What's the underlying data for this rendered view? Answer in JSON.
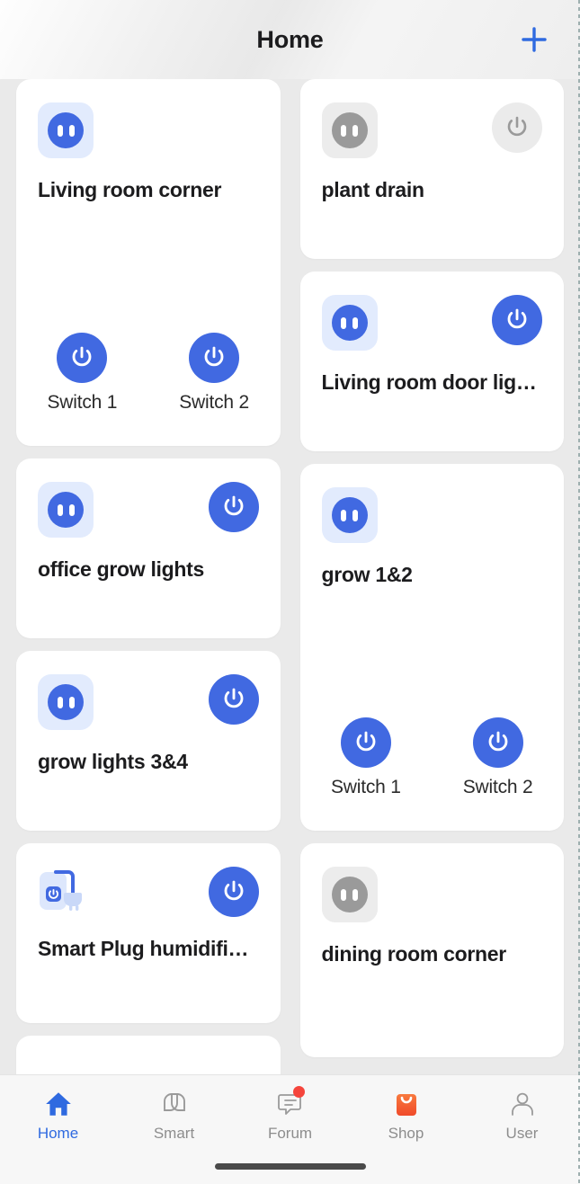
{
  "header": {
    "title": "Home",
    "add_icon": "plus-icon"
  },
  "columns": [
    {
      "cards": [
        {
          "name": "Living room corner",
          "icon": "outlet-icon",
          "state": "on",
          "has_power_button": false,
          "switches": [
            {
              "label": "Switch 1",
              "state": "on"
            },
            {
              "label": "Switch 2",
              "state": "on"
            }
          ]
        },
        {
          "name": "office grow lights",
          "icon": "outlet-icon",
          "state": "on",
          "has_power_button": true,
          "power_state": "on",
          "switches": []
        },
        {
          "name": "grow lights 3&4",
          "icon": "outlet-icon",
          "state": "on",
          "has_power_button": true,
          "power_state": "on",
          "switches": []
        },
        {
          "name": "Smart Plug humidifi…",
          "icon": "smart-plug-icon",
          "state": "on",
          "has_power_button": true,
          "power_state": "on",
          "switches": []
        }
      ]
    },
    {
      "cards": [
        {
          "name": "plant drain",
          "icon": "outlet-icon",
          "state": "off",
          "has_power_button": true,
          "power_state": "off",
          "switches": []
        },
        {
          "name": "Living room door lig…",
          "icon": "outlet-icon",
          "state": "on",
          "has_power_button": true,
          "power_state": "on",
          "switches": []
        },
        {
          "name": "grow 1&2",
          "icon": "outlet-icon",
          "state": "on",
          "has_power_button": false,
          "switches": [
            {
              "label": "Switch 1",
              "state": "on"
            },
            {
              "label": "Switch 2",
              "state": "on"
            }
          ]
        },
        {
          "name": "dining room corner",
          "icon": "outlet-icon",
          "state": "off",
          "has_power_button": false,
          "switches": []
        }
      ]
    }
  ],
  "tabbar": {
    "items": [
      {
        "label": "Home",
        "icon": "home-icon",
        "active": true,
        "badge": false
      },
      {
        "label": "Smart",
        "icon": "smart-icon",
        "active": false,
        "badge": false
      },
      {
        "label": "Forum",
        "icon": "forum-icon",
        "active": false,
        "badge": true
      },
      {
        "label": "Shop",
        "icon": "shop-icon",
        "active": false,
        "badge": false
      },
      {
        "label": "User",
        "icon": "user-icon",
        "active": false,
        "badge": false
      }
    ]
  },
  "colors": {
    "accent": "#4169e1",
    "accent_text": "#2f6ae0",
    "off_gray": "#9a9a9a",
    "badge_red": "#f5453c",
    "shop_orange": "#f4622c",
    "page_bg": "#eaeaea",
    "card_bg": "#ffffff"
  }
}
